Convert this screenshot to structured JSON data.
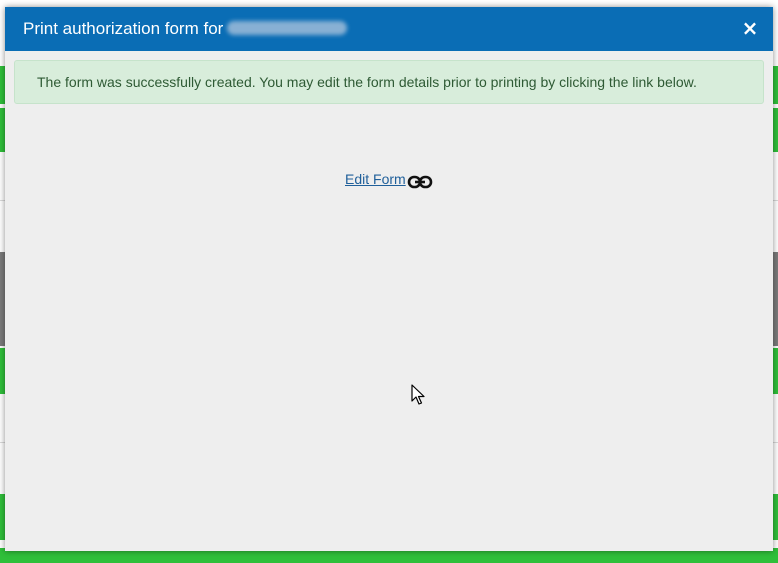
{
  "dialog": {
    "title": "Print authorization form for",
    "close_label": "×"
  },
  "alert": {
    "message": "The form was successfully created. You may edit the form details prior to printing by clicking the link below."
  },
  "edit_link": {
    "label": "Edit Form",
    "icon": "link-icon"
  },
  "colors": {
    "header": "#0a6db5",
    "alert_bg": "#d8eddb",
    "alert_text": "#2e5a34",
    "link": "#1f5f9a",
    "background_green": "#2fbf3a"
  }
}
